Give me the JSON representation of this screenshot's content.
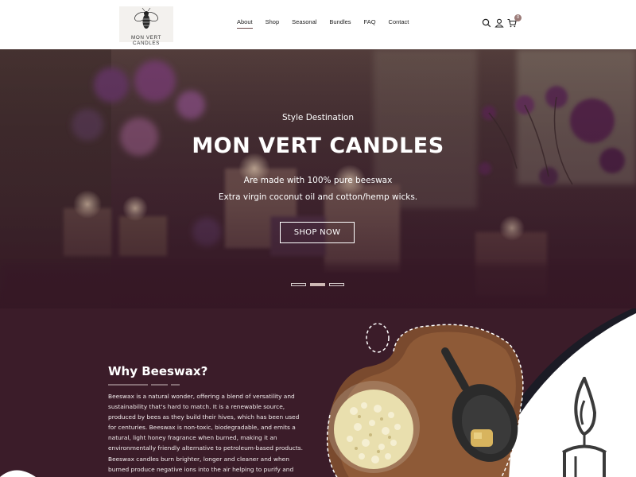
{
  "header": {
    "logo_text": "MON VERT CANDLES",
    "nav": [
      {
        "label": "About",
        "active": true
      },
      {
        "label": "Shop"
      },
      {
        "label": "Seasonal"
      },
      {
        "label": "Bundles"
      },
      {
        "label": "FAQ"
      },
      {
        "label": "Contact"
      }
    ],
    "icons": [
      "search-icon",
      "user-icon",
      "cart-icon"
    ],
    "cart_count": "0"
  },
  "hero": {
    "subtitle": "Style Destination",
    "title": "MON VERT CANDLES",
    "line1": "Are made with 100% pure beeswax",
    "line2": "Extra virgin coconut oil and cotton/hemp wicks.",
    "button": "SHOP NOW",
    "slides": 3,
    "active_slide": 2
  },
  "about": {
    "title": "Why Beeswax?",
    "p1": "Beeswax is a natural wonder, offering a blend of versatility and sustainability that's hard to match. It is a renewable source, produced by bees as they build their hives, which has been used for centuries. Beeswax is non-toxic, biodegradable, and emits a natural, light honey fragrance when burned, making it an environmentally friendly alternative to petroleum-based products. Beeswax candles burn brighter, longer and cleaner and when burned produce negative ions into the air helping to purify and neutralize pollutants."
  },
  "colors": {
    "accent": "#9b7b78",
    "dark_plum": "#3b1c29",
    "nav_underline": "#6b4a4a"
  }
}
